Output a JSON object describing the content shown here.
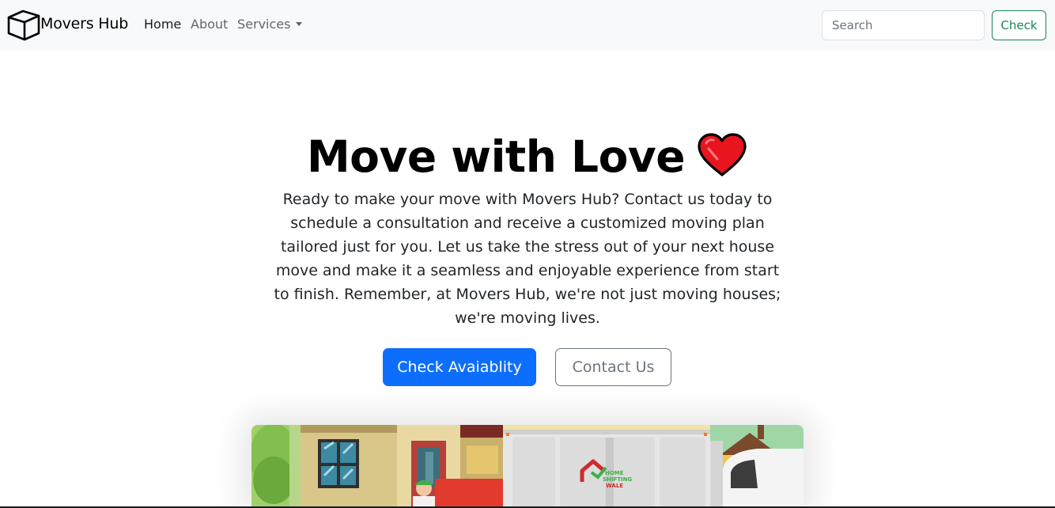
{
  "navbar": {
    "brand": "Movers Hub",
    "brand_icon": "box-icon",
    "links": [
      {
        "label": "Home",
        "active": true
      },
      {
        "label": "About",
        "active": false
      },
      {
        "label": "Services",
        "active": false,
        "dropdown": true
      }
    ],
    "search_placeholder": "Search",
    "check_label": "Check"
  },
  "hero": {
    "title": "Move with Love",
    "title_icon": "heart-icon",
    "lead": "Ready to make your move with Movers Hub? Contact us today to schedule a consultation and receive a customized moving plan tailored just for you. Let us take the stress out of your next house move and make it a seamless and enjoyable experience from start to finish. Remember, at Movers Hub, we're not just moving houses; we're moving lives.",
    "primary_button": "Check Avaiablity",
    "secondary_button": "Contact Us",
    "image_logo_text": "HOME SHIFTING WALE"
  },
  "colors": {
    "primary": "#0d6efd",
    "success": "#198754",
    "secondary": "#6c757d",
    "navbar_bg": "#f8f9fa"
  }
}
